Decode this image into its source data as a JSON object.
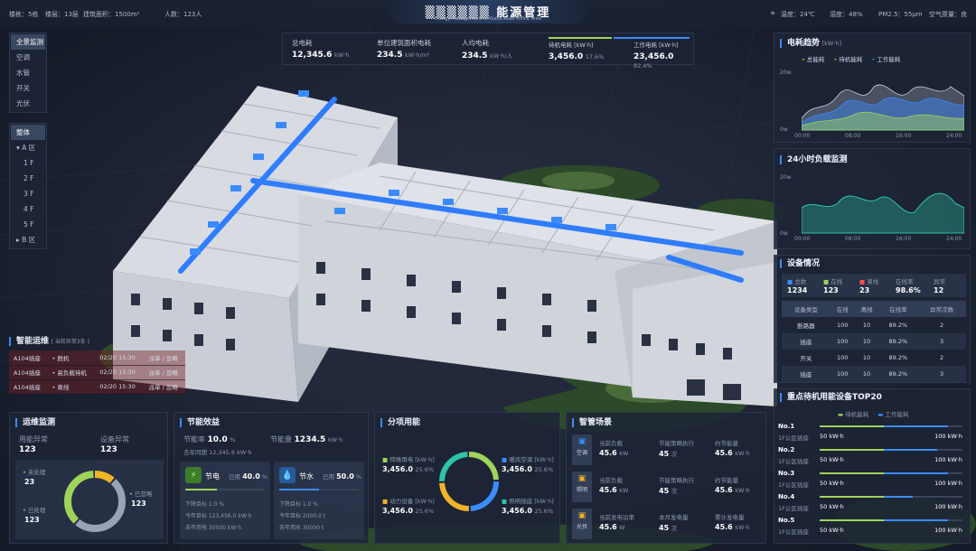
{
  "top": {
    "floors": "楼栋：5栋",
    "layers": "楼层：13层",
    "area": "建筑面积：1500m²",
    "people": "人数：123人",
    "title": "▒▒▒▒▒▒ 能源管理",
    "subtitle": "Energy Management of Yusha Road Office Area",
    "temp": "温度：24℃",
    "humidity": "湿度：48%",
    "pm": "PM2.5：55μm",
    "air": "空气质量：良"
  },
  "nav": {
    "modes": [
      "全景监测",
      "空调",
      "水管",
      "开关",
      "光伏"
    ],
    "scope": [
      "整体",
      "▾ A 区",
      "1 F",
      "2 F",
      "3 F",
      "4 F",
      "5 F",
      "▸ B 区"
    ]
  },
  "kpi": {
    "total_label": "总电耗",
    "total_value": "12,345.6",
    "total_unit": "kW·h",
    "unit_label": "单位建筑面积电耗",
    "unit_value": "234.5",
    "unit_unit": "kW·h/m²",
    "per_label": "人均电耗",
    "per_value": "234.5",
    "per_unit": "kW·h/人",
    "standby_label": "待机电耗 [kW·h]",
    "standby_value": "3,456.0",
    "standby_pct": "17.6%",
    "work_label": "工作电耗 [kW·h]",
    "work_value": "23,456.0",
    "work_pct": "82.4%"
  },
  "trend": {
    "title": "电耗趋势",
    "unit": "[kW·h]",
    "legend": [
      "总能耗",
      "待机能耗",
      "工作能耗"
    ],
    "ytop": "20w",
    "ybot": "0w",
    "xticks": [
      "00:00",
      "08:00",
      "16:00",
      "24:00"
    ]
  },
  "load": {
    "title": "24小时负载监测",
    "ytop": "20w",
    "ybot": "0w",
    "xticks": [
      "00:00",
      "08:00",
      "16:00",
      "24:00"
    ]
  },
  "device": {
    "title": "设备情况",
    "summary": [
      {
        "label": "总数",
        "value": "1234"
      },
      {
        "label": "在线",
        "value": "123"
      },
      {
        "label": "离线",
        "value": "23"
      },
      {
        "label": "在线率",
        "value": "98.6%"
      },
      {
        "label": "异常",
        "value": "12"
      }
    ],
    "headers": [
      "设备类型",
      "在线",
      "离线",
      "在线率",
      "异常次数"
    ],
    "rows": [
      [
        "断路器",
        "100",
        "10",
        "89.2%",
        "2"
      ],
      [
        "插座",
        "100",
        "10",
        "89.2%",
        "3"
      ],
      [
        "开关",
        "100",
        "10",
        "89.2%",
        "2"
      ],
      [
        "插座",
        "100",
        "10",
        "89.2%",
        "3"
      ]
    ]
  },
  "top20": {
    "title": "重点待机用能设备TOP20",
    "legend": [
      "待机能耗",
      "工作能耗"
    ],
    "items": [
      {
        "no": "No.1",
        "name": "1F公区插座",
        "standby": "50 kW·h",
        "work": "100 kW·h",
        "s": 0.45,
        "w": 0.9
      },
      {
        "no": "No.2",
        "name": "1F公区插座",
        "standby": "50 kW·h",
        "work": "100 kW·h",
        "s": 0.45,
        "w": 0.82
      },
      {
        "no": "No.3",
        "name": "1F公区插座",
        "standby": "50 kW·h",
        "work": "100 kW·h",
        "s": 0.45,
        "w": 0.9
      },
      {
        "no": "No.4",
        "name": "1F公区插座",
        "standby": "50 kW·h",
        "work": "100 kW·h",
        "s": 0.45,
        "w": 0.65
      },
      {
        "no": "No.5",
        "name": "1F公区插座",
        "standby": "50 kW·h",
        "work": "100 kW·h",
        "s": 0.45,
        "w": 0.9
      }
    ]
  },
  "smart": {
    "title": "智能运维",
    "note": "[ 当前异常3条 ]",
    "rows": [
      {
        "name": "A104插座",
        "status": "• 脱机",
        "time": "02/20 15:30",
        "action": "派单 / 忽略"
      },
      {
        "name": "A104插座",
        "status": "• 高负载待机",
        "time": "02/20 15:30",
        "action": "派单 / 忽略"
      },
      {
        "name": "A104插座",
        "status": "• 离线",
        "time": "02/20 15:30",
        "action": "派单 / 忽略"
      }
    ]
  },
  "ops": {
    "title": "运维监测",
    "energy_label": "用能异常",
    "energy_value": "123",
    "device_label": "设备异常",
    "device_value": "123",
    "pending_label": "未处理",
    "pending_value": "23",
    "closed_label": "已忽略",
    "closed_value": "123",
    "done_label": "已处理",
    "done_value": "123",
    "ring": {
      "pending": 0.12,
      "closed": 0.5,
      "done": 0.38
    }
  },
  "saving": {
    "title": "节能效益",
    "rate_label": "节能率",
    "rate_value": "10.0",
    "rate_unit": "%",
    "amount_label": "节能量",
    "amount_value": "1234.5",
    "amount_unit": "kW·h",
    "last_year": "去年同期 12,345.6 kW·h",
    "elec": {
      "label": "节电",
      "used_label": "已用",
      "used": "40.0",
      "unit": "%",
      "fill": 0.4,
      "target": "下降目标 1.0 %",
      "plan": "今年目标 123,456.0 kW·h",
      "last": "去年用电 30000 kW·h"
    },
    "water": {
      "label": "节水",
      "used_label": "已用",
      "used": "50.0",
      "unit": "%",
      "fill": 0.5,
      "target": "下降目标 1.0 %",
      "plan": "今年目标 2000.0 t",
      "last": "去年用水 30000 t"
    }
  },
  "split": {
    "title": "分项用能",
    "items": [
      {
        "label": "特殊用电 [kW·h]",
        "value": "3,456.0",
        "pct": "25.6%",
        "color": "#9fd45a"
      },
      {
        "label": "暖风空调 [kW·h]",
        "value": "3,456.0",
        "pct": "25.6%",
        "color": "#3b8cff"
      },
      {
        "label": "动力设备 [kW·h]",
        "value": "3,456.0",
        "pct": "25.6%",
        "color": "#f0b429"
      },
      {
        "label": "照明插座 [kW·h]",
        "value": "3,456.0",
        "pct": "25.6%",
        "color": "#2ec4a8"
      }
    ],
    "ring": [
      0.25,
      0.25,
      0.25,
      0.25
    ]
  },
  "scene": {
    "title": "智管场景",
    "rows": [
      {
        "icon": "空调",
        "l1": "当前负载",
        "v1": "45.6",
        "u1": "kW",
        "l2": "节能策略执行",
        "v2": "45",
        "u2": "次",
        "l3": "约节能量",
        "v3": "45.6",
        "u3": "kW·h",
        "color": "#3b8cff"
      },
      {
        "icon": "照明",
        "l1": "当前负载",
        "v1": "45.6",
        "u1": "kW",
        "l2": "节能策略执行",
        "v2": "45",
        "u2": "次",
        "l3": "约节能量",
        "v3": "45.6",
        "u3": "kW·h",
        "color": "#f0b429"
      },
      {
        "icon": "光伏",
        "l1": "当前发电功率",
        "v1": "45.6",
        "u1": "W",
        "l2": "本月发电量",
        "v2": "45",
        "u2": "次",
        "l3": "累计发电量",
        "v3": "45.6",
        "u3": "kW·h",
        "color": "#f0b429"
      }
    ]
  }
}
